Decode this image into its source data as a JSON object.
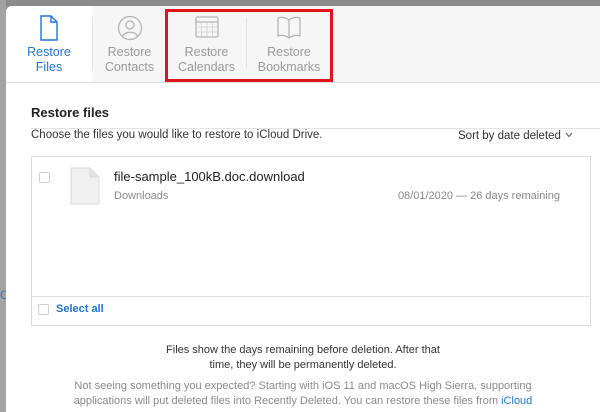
{
  "background": {
    "partial_letter": "C"
  },
  "tabs": [
    {
      "label": "Restore\nFiles",
      "icon": "document-icon",
      "active": true
    },
    {
      "label": "Restore\nContacts",
      "icon": "contacts-icon",
      "active": false
    },
    {
      "label": "Restore\nCalendars",
      "icon": "calendar-icon",
      "active": false
    },
    {
      "label": "Restore\nBookmarks",
      "icon": "book-icon",
      "active": false
    }
  ],
  "main": {
    "title": "Restore files",
    "subtitle": "Choose the files you would like to restore to iCloud Drive.",
    "sort_label": "Sort by date deleted"
  },
  "files": [
    {
      "name": "file-sample_100kB.doc.download",
      "location": "Downloads",
      "deleted_info": "08/01/2020 — 26 days remaining"
    }
  ],
  "select_all_label": "Select all",
  "footer": {
    "retention_note": "Files show the days remaining before deletion. After that time, they will be permanently deleted.",
    "help_text": "Not seeing something you expected? Starting with iOS 11 and macOS High Sierra, supporting applications will put deleted files into Recently Deleted. You can restore these files from",
    "help_link": "iCloud"
  },
  "colors": {
    "accent": "#1f74d6",
    "highlight": "#e0151b",
    "overlay": "#8c8c8c"
  }
}
